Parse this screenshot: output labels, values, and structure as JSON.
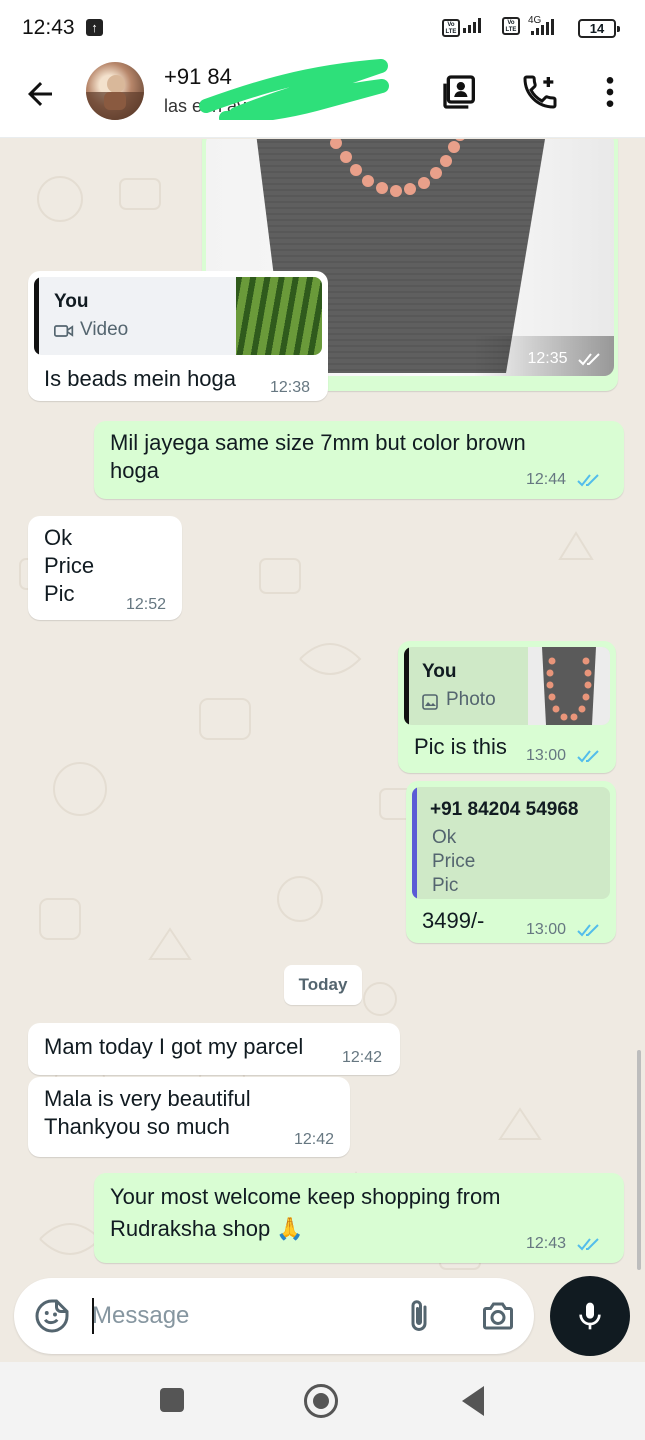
{
  "status_bar": {
    "time": "12:43",
    "network_label": "4G",
    "battery": "14"
  },
  "header": {
    "contact_name": "+91 84",
    "contact_status": "las     een      ay at 12:43"
  },
  "messages": {
    "m1": {
      "time": "12:35"
    },
    "m2": {
      "quote_author": "You",
      "quote_kind": "Video",
      "text": "Is beads mein hoga",
      "time": "12:38"
    },
    "m3": {
      "line1": "Mil jayega same size 7mm but color brown",
      "line2": "hoga",
      "time": "12:44"
    },
    "m4": {
      "line1": "Ok",
      "line2": "Price",
      "line3": "Pic",
      "time": "12:52"
    },
    "m5": {
      "quote_author": "You",
      "quote_kind": "Photo",
      "text": "Pic is this",
      "time": "13:00"
    },
    "m6": {
      "quote_author": "+91 84204 54968",
      "quote_line1": "Ok",
      "quote_line2": "Price",
      "quote_line3": "Pic",
      "text": "3499/-",
      "time": "13:00"
    },
    "date_chip": "Today",
    "m7": {
      "text": "Mam today I got my parcel",
      "time": "12:42"
    },
    "m8": {
      "line1": "Mala is very beautiful",
      "line2": "Thankyou so much",
      "time": "12:42"
    },
    "m9": {
      "line1": "Your most welcome keep shopping from",
      "line2": "Rudraksha shop 🙏",
      "time": "12:43"
    }
  },
  "composer": {
    "placeholder": "Message"
  },
  "colors": {
    "outgoing_bubble": "#d9fdd3",
    "incoming_bubble": "#ffffff",
    "read_ticks": "#53bdeb",
    "chat_background": "#efeae2",
    "scribble": "#2ee07a"
  },
  "icons": [
    "back-arrow-icon",
    "add-contact-card-icon",
    "add-call-icon",
    "more-vert-icon",
    "sticker-icon",
    "attach-icon",
    "camera-icon",
    "mic-icon",
    "video-icon",
    "photo-icon"
  ]
}
